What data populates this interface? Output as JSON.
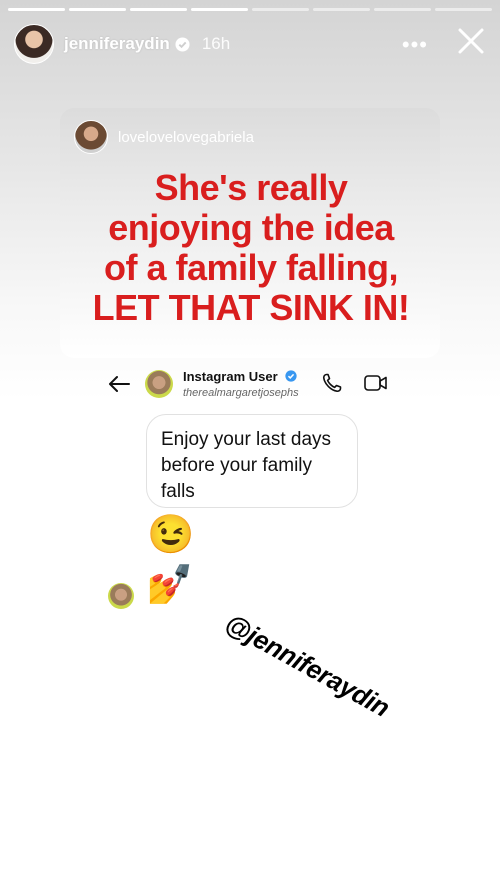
{
  "story": {
    "progress_segments": 8,
    "progress_completed": 4
  },
  "header": {
    "username": "jenniferaydin",
    "time": "16h",
    "more_icon": "more-horizontal-icon",
    "close_icon": "close-icon"
  },
  "quote_card": {
    "username": "lovelovelovegabriela"
  },
  "headline": {
    "line1": "She's really",
    "line2": "enjoying the idea",
    "line3": "of a family falling,",
    "line4": "LET THAT SINK IN!"
  },
  "dm": {
    "name": "Instagram User",
    "handle": "therealmargaretjosephs",
    "message_line1": "Enjoy your last days",
    "message_line2": "before your family",
    "message_line3": "falls",
    "emoji1": "😉",
    "emoji2": "💅"
  },
  "mention": {
    "text": "@jenniferaydin"
  },
  "colors": {
    "headline": "#d91e1e",
    "verified": "#3897f0"
  }
}
